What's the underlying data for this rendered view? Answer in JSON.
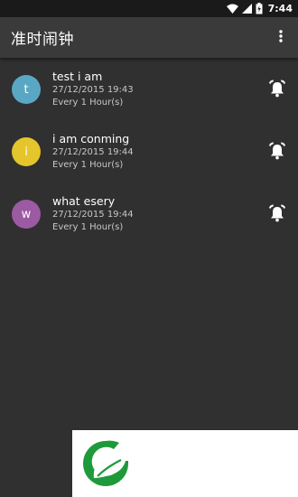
{
  "status_bar": {
    "time": "7:44",
    "icons": [
      "wifi-icon",
      "cellular-signal-icon",
      "battery-charging-icon"
    ]
  },
  "app_bar": {
    "title": "准时闹钟",
    "menu_icon": "more-vert-icon"
  },
  "alarms": [
    {
      "initial": "t",
      "avatar_color": "#5aa7c5",
      "title": "test i am",
      "date": "27/12/2015 19:43",
      "repeat": "Every 1 Hour(s)",
      "icon": "alarm-bell-icon"
    },
    {
      "initial": "i",
      "avatar_color": "#e4c52b",
      "title": "i am conming",
      "date": "27/12/2015 19:44",
      "repeat": "Every 1 Hour(s)",
      "icon": "alarm-bell-icon"
    },
    {
      "initial": "w",
      "avatar_color": "#9c5aa3",
      "title": "what esery",
      "date": "27/12/2015 19:44",
      "repeat": "Every 1 Hour(s)",
      "icon": "alarm-bell-icon"
    }
  ],
  "colors": {
    "background": "#303030",
    "app_bar": "#3a3a3a",
    "status_bar": "#1a1a1a",
    "logo_green": "#1f9a3a"
  },
  "banner": {
    "logo_icon": "green-leaf-g-logo-icon"
  }
}
